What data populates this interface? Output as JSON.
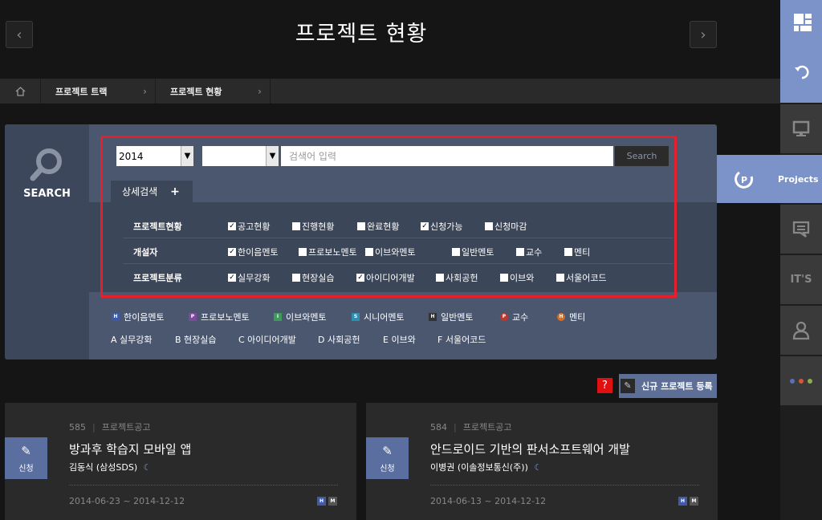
{
  "header": {
    "title": "프로젝트 현황",
    "prev_icon": "chevron-left",
    "next_icon": "chevron-right"
  },
  "breadcrumb": [
    {
      "label": "프로젝트 트랙"
    },
    {
      "label": "프로젝트 현황"
    }
  ],
  "search": {
    "side_label": "SEARCH",
    "year": "2014",
    "category": "",
    "placeholder": "검색어 입력",
    "button": "Search",
    "detail_tab": "상세검색",
    "detail_plus": "+",
    "rows": [
      {
        "label": "프로젝트현황",
        "options": [
          {
            "label": "공고현황",
            "checked": true
          },
          {
            "label": "진행현황",
            "checked": false
          },
          {
            "label": "완료현황",
            "checked": false
          },
          {
            "label": "신청가능",
            "checked": true
          },
          {
            "label": "신청마감",
            "checked": false
          }
        ]
      },
      {
        "label": "개설자",
        "options": [
          {
            "label": "한이음멘토",
            "checked": true
          },
          {
            "label": "프로보노멘토",
            "checked": false
          },
          {
            "label": "이브와멘토",
            "checked": false
          },
          {
            "label": "일반멘토",
            "checked": false
          },
          {
            "label": "교수",
            "checked": false
          },
          {
            "label": "멘티",
            "checked": false
          }
        ]
      },
      {
        "label": "프로젝트분류",
        "options": [
          {
            "label": "실무강화",
            "checked": true
          },
          {
            "label": "현장실습",
            "checked": false
          },
          {
            "label": "아이디어개발",
            "checked": true
          },
          {
            "label": "사회공헌",
            "checked": false
          },
          {
            "label": "이브와",
            "checked": false
          },
          {
            "label": "서울어코드",
            "checked": false
          }
        ]
      }
    ],
    "legend": [
      {
        "badge": "H",
        "label": "한이음멘토",
        "color": "#3e5aa8"
      },
      {
        "badge": "P",
        "label": "프로보노멘토",
        "color": "#7b4a9a"
      },
      {
        "badge": "I",
        "label": "이브와멘토",
        "color": "#3f9a5a"
      },
      {
        "badge": "S",
        "label": "시니어멘토",
        "color": "#2e8fb0"
      },
      {
        "badge": "H",
        "label": "일반멘토",
        "color": "#333333"
      },
      {
        "badge": "P",
        "label": "교수",
        "color": "#c0352e"
      },
      {
        "badge": "H",
        "label": "멘티",
        "color": "#d0702a"
      }
    ],
    "categories": [
      "A 실무강화",
      "B 현장실습",
      "C 아이디어개발",
      "D 사회공헌",
      "E 이브와",
      "F 서울어코드"
    ]
  },
  "actions": {
    "help": "?",
    "new_project": "신규 프로젝트 등록"
  },
  "cards": [
    {
      "num": "585",
      "type": "프로젝트공고",
      "title": "방과후 학습지 모바일 앱",
      "author": "김동식 (삼성SDS)",
      "date": "2014-06-23 ~ 2014-12-12",
      "apply": "신청",
      "tags": [
        "H",
        "M"
      ]
    },
    {
      "num": "584",
      "type": "프로젝트공고",
      "title": "안드로이드 기반의 판서소프트웨어 개발",
      "author": "이병권 (이솔정보통신(주))",
      "date": "2014-06-13 ~ 2014-12-12",
      "apply": "신청",
      "tags": [
        "H",
        "M"
      ]
    }
  ],
  "sidebar": {
    "active": "Projects",
    "its": "IT'S"
  },
  "colors": {
    "accent": "#7b93c8",
    "highlight": "#e3202b",
    "panel": "#4a576f"
  }
}
